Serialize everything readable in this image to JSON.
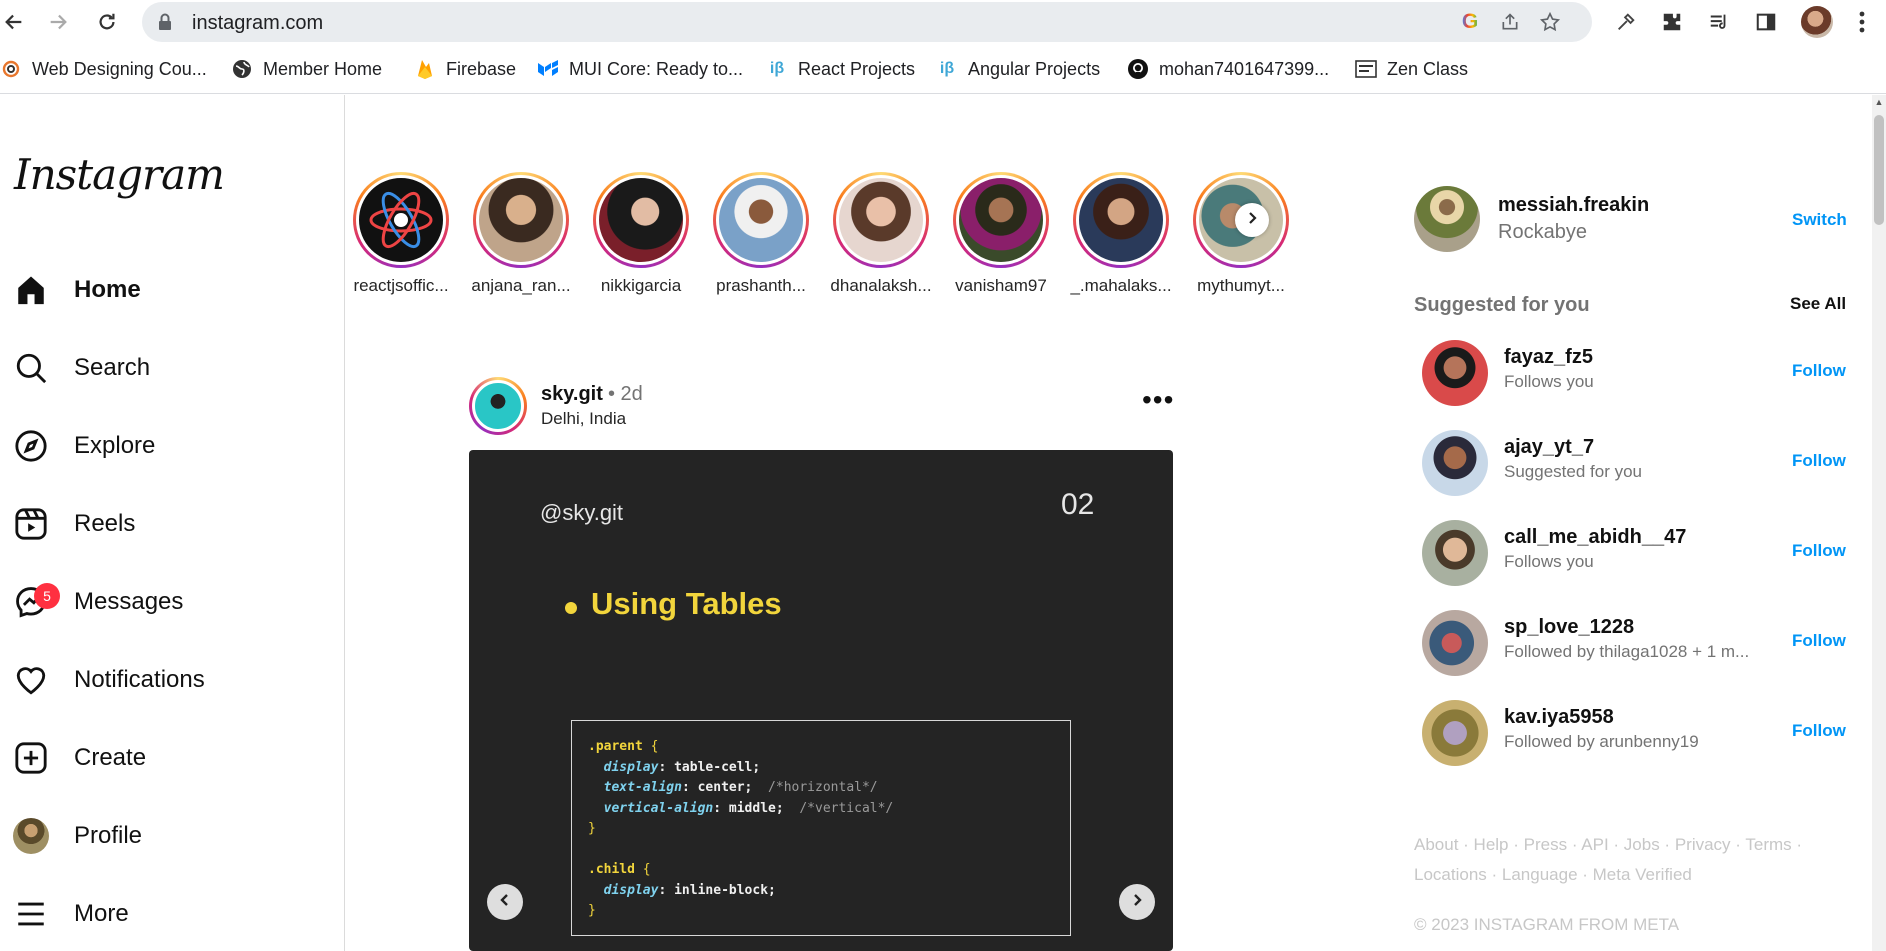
{
  "browser": {
    "url": "instagram.com",
    "bookmarks": [
      {
        "label": "Web Designing Cou...",
        "icon": "swirl-icon"
      },
      {
        "label": "Member Home",
        "icon": "globe-icon"
      },
      {
        "label": "Firebase",
        "icon": "firebase-icon"
      },
      {
        "label": "MUI Core: Ready to...",
        "icon": "mui-icon"
      },
      {
        "label": "React Projects",
        "icon": "ib-icon"
      },
      {
        "label": "Angular Projects",
        "icon": "ib-icon"
      },
      {
        "label": "mohan7401647399...",
        "icon": "github-icon"
      },
      {
        "label": "Zen Class",
        "icon": "zen-class-icon"
      }
    ]
  },
  "sidebar": {
    "logo": "Instagram",
    "items": [
      {
        "label": "Home",
        "icon": "home-icon"
      },
      {
        "label": "Search",
        "icon": "search-icon"
      },
      {
        "label": "Explore",
        "icon": "compass-icon"
      },
      {
        "label": "Reels",
        "icon": "reels-icon"
      },
      {
        "label": "Messages",
        "icon": "messenger-icon",
        "badge": "5"
      },
      {
        "label": "Notifications",
        "icon": "heart-icon"
      },
      {
        "label": "Create",
        "icon": "plus-square-icon"
      },
      {
        "label": "Profile",
        "icon": "avatar"
      },
      {
        "label": "More",
        "icon": "menu-icon"
      }
    ]
  },
  "stories": [
    {
      "name": "reactjsoffic..."
    },
    {
      "name": "anjana_ran..."
    },
    {
      "name": "nikkigarcia"
    },
    {
      "name": "prashanth..."
    },
    {
      "name": "dhanalaksh..."
    },
    {
      "name": "vanisham97"
    },
    {
      "name": "_.mahalaks..."
    },
    {
      "name": "mythumyt..."
    }
  ],
  "post": {
    "username": "sky.git",
    "time": "• 2d",
    "location": "Delhi, India",
    "image": {
      "handle": "@sky.git",
      "slide_number": "02",
      "heading": "Using Tables",
      "code": {
        "l1_sel": ".parent",
        "l1_br": " {",
        "l2_prop": "display",
        "l2_val": ": table-cell;",
        "l3_prop": "text-align",
        "l3_val": ": center;",
        "l3_com": "/*horizontal*/",
        "l4_prop": "vertical-align",
        "l4_val": ": middle;",
        "l4_com": "/*vertical*/",
        "l5_br": "}",
        "l7_sel": ".child",
        "l7_br": " {",
        "l8_prop": "display",
        "l8_val": ": inline-block;",
        "l9_br": "}"
      }
    }
  },
  "right": {
    "username": "messiah.freakin",
    "name": "Rockabye",
    "switch_label": "Switch",
    "suggested_title": "Suggested for you",
    "see_all": "See All",
    "suggestions": [
      {
        "username": "fayaz_fz5",
        "sub": "Follows you",
        "action": "Follow"
      },
      {
        "username": "ajay_yt_7",
        "sub": "Suggested for you",
        "action": "Follow"
      },
      {
        "username": "call_me_abidh__47",
        "sub": "Follows you",
        "action": "Follow"
      },
      {
        "username": "sp_love_1228",
        "sub": "Followed by thilaga1028 + 1 m...",
        "action": "Follow"
      },
      {
        "username": "kav.iya5958",
        "sub": "Followed by arunbenny19",
        "action": "Follow"
      }
    ],
    "footer": {
      "links": [
        "About",
        "Help",
        "Press",
        "API",
        "Jobs",
        "Privacy",
        "Terms",
        "Locations",
        "Language",
        "Meta Verified"
      ],
      "copyright": "© 2023 INSTAGRAM FROM META"
    }
  },
  "colors": {
    "accent": "#0095f6",
    "badge": "#ff3040",
    "post_background": "#242424",
    "post_heading": "#f2d53c"
  }
}
